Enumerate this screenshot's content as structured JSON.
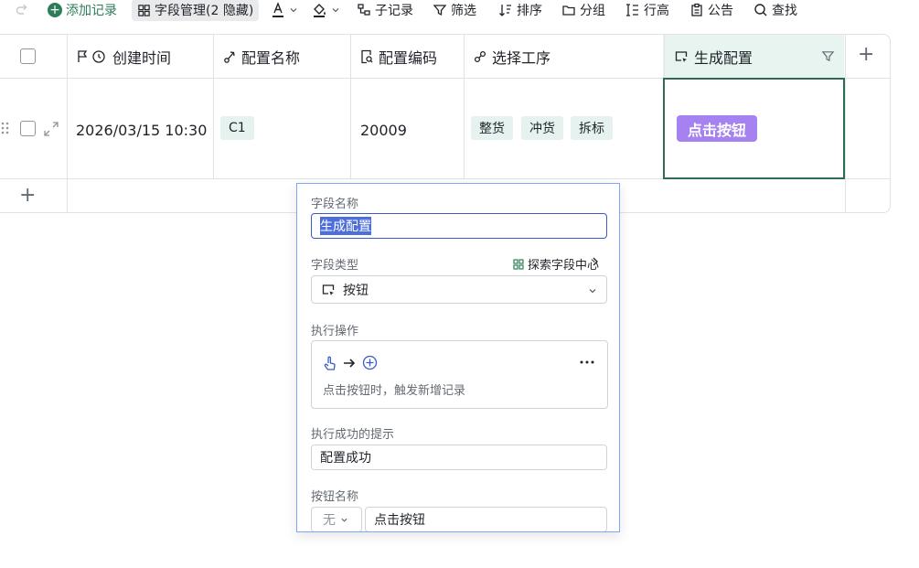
{
  "toolbar": {
    "add_record": "添加记录",
    "field_manage": "字段管理(2 隐藏)",
    "sub_record": "子记录",
    "filter": "筛选",
    "sort": "排序",
    "group": "分组",
    "row_height": "行高",
    "notice": "公告",
    "find": "查找"
  },
  "table": {
    "columns": [
      "创建时间",
      "配置名称",
      "配置编码",
      "选择工序",
      "生成配置"
    ],
    "row": {
      "created_time": "2026/03/15 10:30",
      "config_name": "C1",
      "config_code": "20009",
      "processes": [
        "整货",
        "冲货",
        "拆标"
      ],
      "button_label": "点击按钮"
    }
  },
  "popup": {
    "field_name_label": "字段名称",
    "field_name_value": "生成配置",
    "field_type_label": "字段类型",
    "explore_link": "探索字段中心",
    "field_type_value": "按钮",
    "action_label": "执行操作",
    "action_desc": "点击按钮时，触发新增记录",
    "success_label": "执行成功的提示",
    "success_value": "配置成功",
    "button_name_label": "按钮名称",
    "button_icon_value": "无",
    "button_name_value": "点击按钮"
  },
  "colors": {
    "accent_green": "#2e7d59",
    "button_purple": "#a682f0",
    "popup_border": "#7fa6f8",
    "selected_header": "#e8f4ef"
  }
}
